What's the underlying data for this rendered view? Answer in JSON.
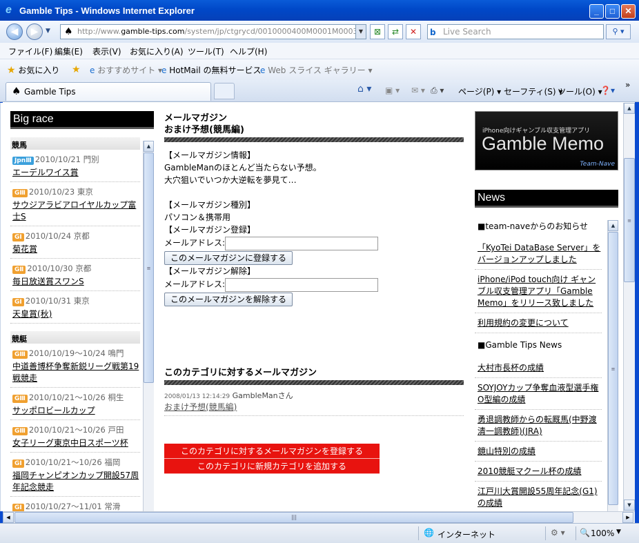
{
  "window": {
    "title": "Gamble Tips - Windows Internet Explorer",
    "controls": [
      "_",
      "□",
      "✕"
    ]
  },
  "address": {
    "url_prefix": "http://www.",
    "url_domain": "gamble-tips.com",
    "url_path": "/system/jp/ctgrycd/0010000400M0001M0003/ma",
    "search_placeholder": "Live Search"
  },
  "menu": [
    "ファイル(F)",
    "編集(E)",
    "表示(V)",
    "お気に入り(A)",
    "ツール(T)",
    "ヘルプ(H)"
  ],
  "favorites": {
    "label": "お気に入り",
    "items": [
      "おすすめサイト ▾",
      "HotMail の無料サービス",
      "Web スライス ギャラリー ▾"
    ]
  },
  "tab": {
    "title": "Gamble Tips"
  },
  "commands": {
    "page": "ページ(P) ▾",
    "safety": "セーフティ(S) ▾",
    "tools": "ツール(O) ▾"
  },
  "left": {
    "heading": "Big race",
    "categories": [
      {
        "label": "競馬",
        "races": [
          {
            "badge": "JpnⅢ",
            "badge_kind": "jpn",
            "date": "2010/10/21",
            "place": "門別",
            "name": "エーデルワイス賞"
          },
          {
            "badge": "GⅢ",
            "badge_kind": "g",
            "date": "2010/10/23",
            "place": "東京",
            "name": "サウジアラビアロイヤルカップ富士S"
          },
          {
            "badge": "GⅠ",
            "badge_kind": "g",
            "date": "2010/10/24",
            "place": "京都",
            "name": "菊花賞"
          },
          {
            "badge": "GⅡ",
            "badge_kind": "g",
            "date": "2010/10/30",
            "place": "京都",
            "name": "毎日放送賞スワンS"
          },
          {
            "badge": "GⅠ",
            "badge_kind": "g",
            "date": "2010/10/31",
            "place": "東京",
            "name": "天皇賞(秋)"
          }
        ]
      },
      {
        "label": "競艇",
        "races": [
          {
            "badge": "GⅢ",
            "badge_kind": "g",
            "date": "2010/10/19～10/24",
            "place": "鳴門",
            "name": "中道善博杯争奪新鋭リーグ戦第19戦競走"
          },
          {
            "badge": "GⅢ",
            "badge_kind": "g",
            "date": "2010/10/21～10/26",
            "place": "桐生",
            "name": "サッポロビールカップ"
          },
          {
            "badge": "GⅢ",
            "badge_kind": "g",
            "date": "2010/10/21～10/26",
            "place": "戸田",
            "name": "女子リーグ東京中日スポーツ杯"
          },
          {
            "badge": "GⅠ",
            "badge_kind": "g",
            "date": "2010/10/21～10/26",
            "place": "福岡",
            "name": "福岡チャンピオンカップ開設57周年記念競走"
          },
          {
            "badge": "GⅠ",
            "badge_kind": "g",
            "date": "2010/10/27～11/01",
            "place": "常滑",
            "name": ""
          }
        ]
      }
    ]
  },
  "main": {
    "title_line1": "メールマガジン",
    "title_line2": "おまけ予想(競馬編)",
    "info_label": "【メールマガジン情報】",
    "info_line1": "GambleManのほとんど当たらない予想。",
    "info_line2": "大穴狙いでいつか大逆転を夢見て…",
    "type_label": "【メールマガジン種別】",
    "type_value": "パソコン＆携帯用",
    "register_label": "【メールマガジン登録】",
    "email_label": "メールアドレス:",
    "register_button": "このメールマガジンに登録する",
    "unregister_label": "【メールマガジン解除】",
    "unregister_button": "このメールマガジンを解除する",
    "category_title": "このカテゴリに対するメールマガジン",
    "post_date": "2008/01/13 12:14:29",
    "post_author": "GambleManさん",
    "post_link": "おまけ予想(競馬編)",
    "red_btn1": "このカテゴリに対するメールマガジンを登録する",
    "red_btn2": "このカテゴリに新規カテゴリを追加する"
  },
  "right": {
    "banner_sub": "iPhone向けギャンブル収支管理アプリ",
    "banner_title": "Gamble Memo",
    "banner_team": "Team-Nave",
    "news_heading": "News",
    "sec1": "■team-naveからのお知らせ",
    "items1": [
      "「KyoTei DataBase Server」をバージョンアップしました",
      "iPhone/iPod touch向け ギャンブル収支管理アプリ「Gamble Memo」をリリース致しました",
      "利用規約の変更について"
    ],
    "sec2": "■Gamble Tips News",
    "items2": [
      "大村市長杯の成績",
      "SOYJOYカップ争奪血液型選手権O型編の成績",
      "勇退調教師からの転厩馬(中野渡清一調教師)(JRA)",
      "鏡山特別の成績",
      "2010競艇マクール杯の成績",
      "江戸川大賞開設55周年記念(G1)の成績"
    ]
  },
  "status": {
    "zone": "インターネット",
    "zoom": "100%"
  }
}
